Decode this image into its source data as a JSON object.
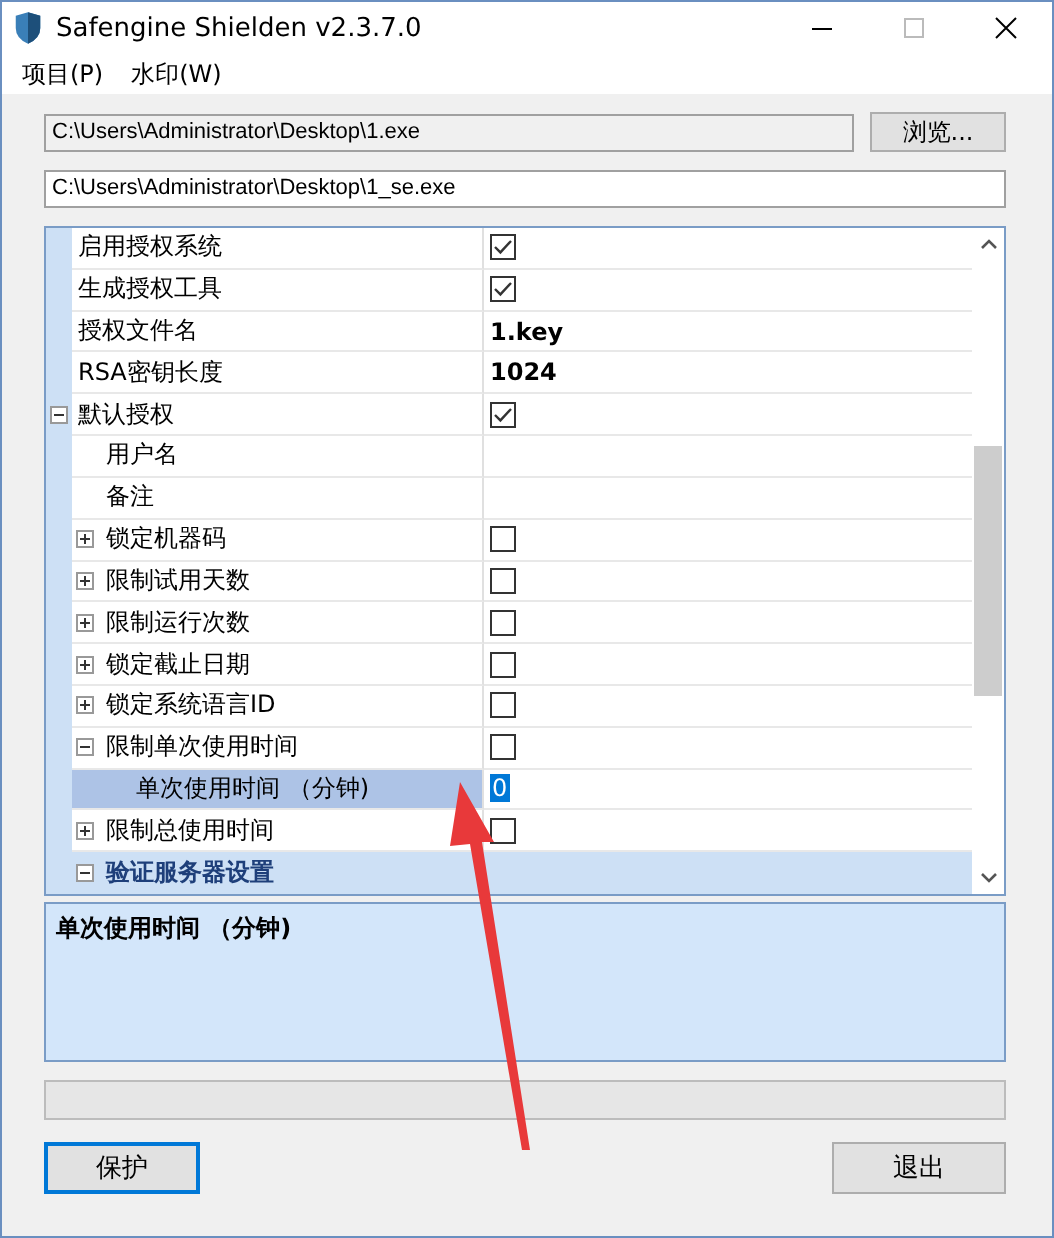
{
  "window": {
    "title": "Safengine Shielden v2.3.7.0"
  },
  "menu": [
    {
      "label": "项目(P)"
    },
    {
      "label": "水印(W)"
    }
  ],
  "input_file": {
    "value": "C:\\Users\\Administrator\\Desktop\\1.exe",
    "disabled": true
  },
  "browse_button": {
    "label": "浏览..."
  },
  "output_file": {
    "value": "C:\\Users\\Administrator\\Desktop\\1_se.exe",
    "disabled": false
  },
  "properties": [
    {
      "name": "启用授权系统",
      "kind": "check",
      "checked": true,
      "selected": false
    },
    {
      "name": "生成授权工具",
      "kind": "check",
      "checked": true,
      "selected": false
    },
    {
      "name": "授权文件名",
      "kind": "text",
      "value": "1.key",
      "selected": false
    },
    {
      "name": "RSA密钥长度",
      "kind": "text",
      "value": "1024",
      "selected": false
    },
    {
      "name": "默认授权",
      "kind": "check",
      "checked": true,
      "selected": false,
      "expanded": true,
      "children": [
        {
          "name": "用户名",
          "kind": "text",
          "selected": false
        },
        {
          "name": "备注",
          "kind": "text",
          "selected": false
        },
        {
          "name": "锁定机器码",
          "kind": "check",
          "checked": false,
          "selected": false,
          "expanded": false
        },
        {
          "name": "限制试用天数",
          "kind": "check",
          "checked": false,
          "selected": false,
          "expanded": false
        },
        {
          "name": "限制运行次数",
          "kind": "check",
          "checked": false,
          "selected": false,
          "expanded": false
        },
        {
          "name": "锁定截止日期",
          "kind": "check",
          "checked": false,
          "selected": false,
          "expanded": false
        },
        {
          "name": "锁定系统语言ID",
          "kind": "check",
          "checked": false,
          "selected": false,
          "expanded": false
        },
        {
          "name": "限制单次使用时间",
          "kind": "check",
          "checked": false,
          "selected": false,
          "expanded": true,
          "children": [
            {
              "name": "单次使用时间 （分钟)",
              "kind": "text",
              "value": "0",
              "selected": true
            }
          ]
        },
        {
          "name": "限制总使用时间",
          "kind": "check",
          "checked": false,
          "selected": false,
          "expanded": false
        }
      ]
    },
    {
      "name": "验证服务器设置",
      "kind": "category",
      "selected": false,
      "expanded": true
    }
  ],
  "description": {
    "title": "单次使用时间 （分钟)"
  },
  "buttons": [
    {
      "label": "保护"
    },
    {
      "label": "退出"
    }
  ]
}
